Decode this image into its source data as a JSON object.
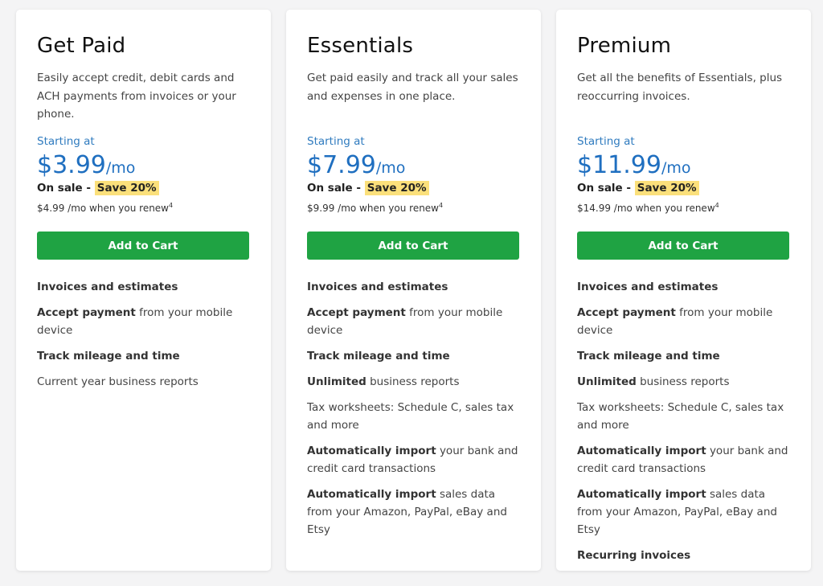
{
  "plans": [
    {
      "title": "Get Paid",
      "description": "Easily accept credit, debit cards and ACH payments from invoices or your phone.",
      "starting_label": "Starting at",
      "price": "$3.99",
      "period": "/mo",
      "sale_prefix": "On sale - ",
      "sale_badge": "Save 20%",
      "renew_text": "$4.99 /mo when you renew",
      "renew_footnote": "4",
      "button_label": "Add to Cart",
      "features": [
        {
          "bold": "Invoices and estimates",
          "rest": ""
        },
        {
          "bold": "Accept payment",
          "rest": " from your mobile device"
        },
        {
          "bold": "Track mileage and time",
          "rest": ""
        },
        {
          "bold": "",
          "rest": "Current year business reports"
        }
      ]
    },
    {
      "title": "Essentials",
      "description": "Get paid easily and track all your sales and expenses in one place.",
      "starting_label": "Starting at",
      "price": "$7.99",
      "period": "/mo",
      "sale_prefix": "On sale - ",
      "sale_badge": "Save 20%",
      "renew_text": "$9.99 /mo when you renew",
      "renew_footnote": "4",
      "button_label": "Add to Cart",
      "features": [
        {
          "bold": "Invoices and estimates",
          "rest": ""
        },
        {
          "bold": "Accept payment",
          "rest": " from your mobile device"
        },
        {
          "bold": "Track mileage and time",
          "rest": ""
        },
        {
          "bold": "Unlimited",
          "rest": " business reports"
        },
        {
          "bold": "",
          "rest": "Tax worksheets: Schedule C, sales tax and more"
        },
        {
          "bold": "Automatically import",
          "rest": " your bank and credit card transactions"
        },
        {
          "bold": "Automatically import",
          "rest": " sales data from your Amazon, PayPal, eBay and Etsy"
        }
      ]
    },
    {
      "title": "Premium",
      "description": "Get all the benefits of Essentials, plus reoccurring invoices.",
      "starting_label": "Starting at",
      "price": "$11.99",
      "period": "/mo",
      "sale_prefix": "On sale - ",
      "sale_badge": "Save 20%",
      "renew_text": "$14.99 /mo when you renew",
      "renew_footnote": "4",
      "button_label": "Add to Cart",
      "features": [
        {
          "bold": "Invoices and estimates",
          "rest": ""
        },
        {
          "bold": "Accept payment",
          "rest": " from your mobile device"
        },
        {
          "bold": "Track mileage and time",
          "rest": ""
        },
        {
          "bold": "Unlimited",
          "rest": " business reports"
        },
        {
          "bold": "",
          "rest": "Tax worksheets: Schedule C, sales tax and more"
        },
        {
          "bold": "Automatically import",
          "rest": " your bank and credit card transactions"
        },
        {
          "bold": "Automatically import",
          "rest": " sales data from your Amazon, PayPal, eBay and Etsy"
        },
        {
          "bold": "Recurring invoices",
          "rest": ""
        }
      ]
    }
  ],
  "colors": {
    "price_blue": "#1f6fc0",
    "button_green": "#1fa343",
    "highlight_yellow": "#fbe07b"
  }
}
